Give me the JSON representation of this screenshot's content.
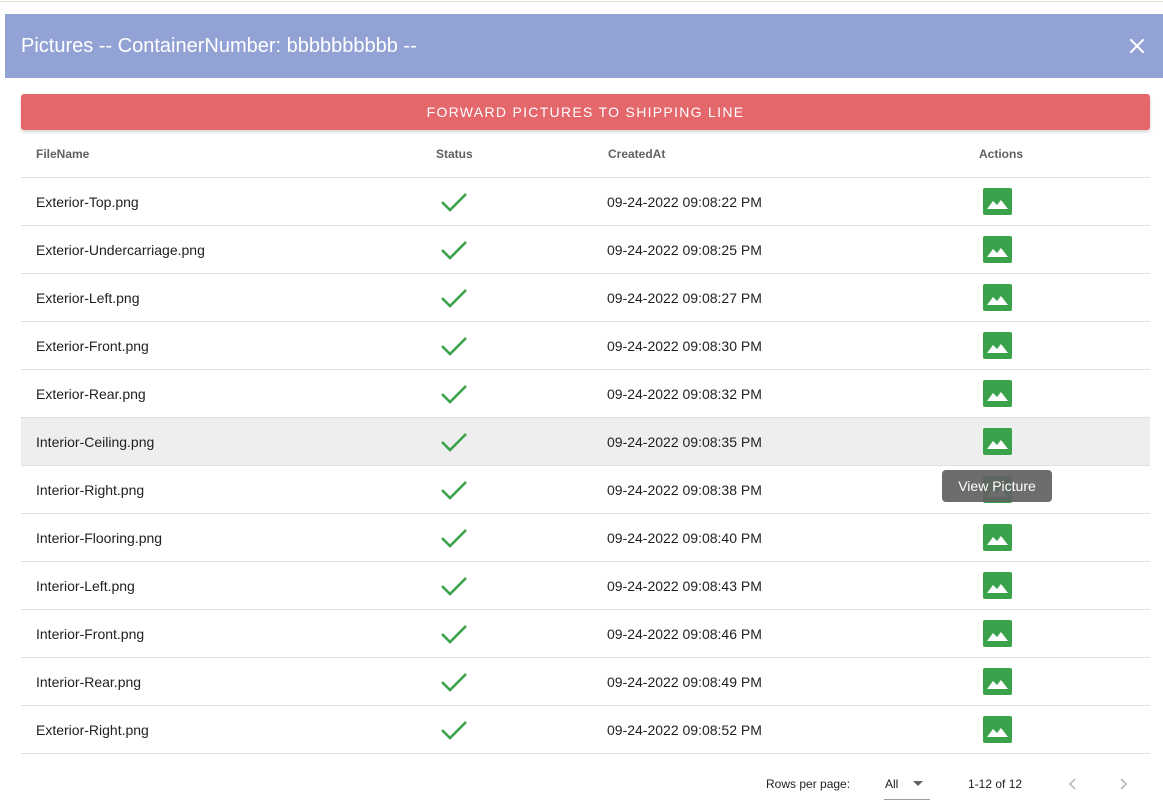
{
  "dialog": {
    "title": "Pictures -- ContainerNumber: bbbbbbbbbb --",
    "close_icon": "close-icon",
    "header_color": "#93a2d5"
  },
  "forward_button": {
    "label": "FORWARD PICTURES TO SHIPPING LINE",
    "color": "#e3676b"
  },
  "table": {
    "columns": [
      "FileName",
      "Status",
      "CreatedAt",
      "Actions"
    ],
    "status_icon": "check-icon",
    "action_icon": "image-icon",
    "accent_color": "#3ba24c",
    "hovered_row": 5,
    "rows": [
      {
        "filename": "Exterior-Top.png",
        "created_at": "09-24-2022 09:08:22 PM"
      },
      {
        "filename": "Exterior-Undercarriage.png",
        "created_at": "09-24-2022 09:08:25 PM"
      },
      {
        "filename": "Exterior-Left.png",
        "created_at": "09-24-2022 09:08:27 PM"
      },
      {
        "filename": "Exterior-Front.png",
        "created_at": "09-24-2022 09:08:30 PM"
      },
      {
        "filename": "Exterior-Rear.png",
        "created_at": "09-24-2022 09:08:32 PM"
      },
      {
        "filename": "Interior-Ceiling.png",
        "created_at": "09-24-2022 09:08:35 PM"
      },
      {
        "filename": "Interior-Right.png",
        "created_at": "09-24-2022 09:08:38 PM"
      },
      {
        "filename": "Interior-Flooring.png",
        "created_at": "09-24-2022 09:08:40 PM"
      },
      {
        "filename": "Interior-Left.png",
        "created_at": "09-24-2022 09:08:43 PM"
      },
      {
        "filename": "Interior-Front.png",
        "created_at": "09-24-2022 09:08:46 PM"
      },
      {
        "filename": "Interior-Rear.png",
        "created_at": "09-24-2022 09:08:49 PM"
      },
      {
        "filename": "Exterior-Right.png",
        "created_at": "09-24-2022 09:08:52 PM"
      }
    ]
  },
  "tooltip": {
    "text": "View Picture"
  },
  "pagination": {
    "rows_per_page_label": "Rows per page:",
    "rows_per_page_value": "All",
    "range_text": "1-12 of 12",
    "prev_icon": "chevron-left-icon",
    "next_icon": "chevron-right-icon"
  }
}
